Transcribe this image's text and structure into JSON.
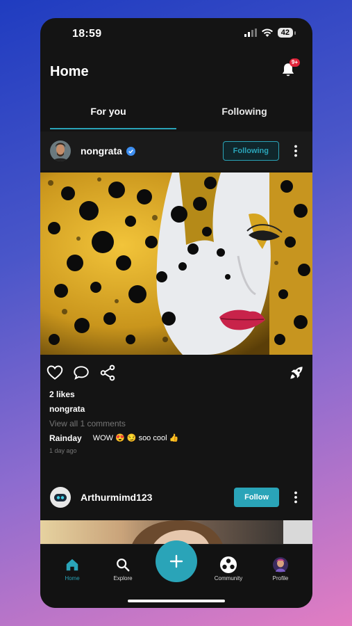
{
  "status_bar": {
    "time": "18:59",
    "battery": "42"
  },
  "header": {
    "title": "Home",
    "notification_badge": "9+"
  },
  "tabs": [
    {
      "label": "For you",
      "active": true
    },
    {
      "label": "Following",
      "active": false
    }
  ],
  "post1": {
    "username": "nongrata",
    "follow_state": "Following",
    "likes": "2 likes",
    "caption_user": "nongrata",
    "view_comments": "View all 1 comments",
    "comment": {
      "user": "Rainday",
      "text": "WOW 😍 😏 soo cool 👍"
    },
    "time_ago": "1 day ago"
  },
  "post2": {
    "username": "Arthurmimd123",
    "follow_label": "Follow"
  },
  "nav": {
    "items": [
      {
        "label": "Home",
        "icon": "home-icon"
      },
      {
        "label": "Explore",
        "icon": "search-icon"
      },
      {
        "label": "Community",
        "icon": "community-icon"
      },
      {
        "label": "Profile",
        "icon": "profile-avatar-icon"
      }
    ],
    "fab_icon": "plus-icon"
  },
  "colors": {
    "accent": "#2aa4b8",
    "background": "#141414",
    "badge": "#e0243a"
  }
}
